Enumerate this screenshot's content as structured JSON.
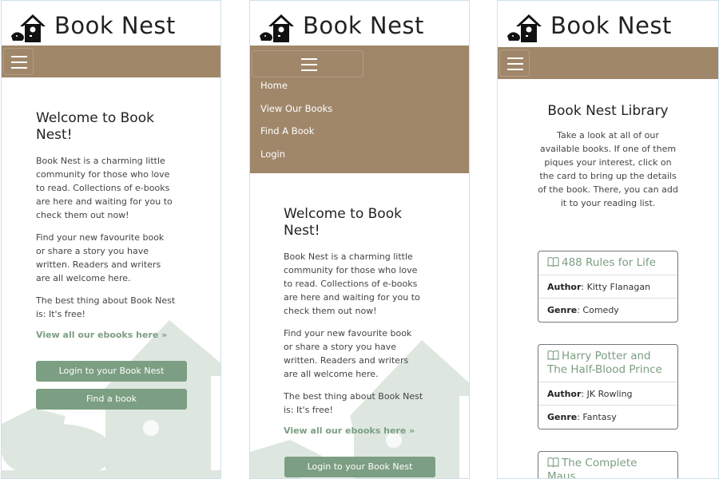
{
  "brand": {
    "name": "Book Nest"
  },
  "colors": {
    "navbar": "#a0876a",
    "accent": "#7c9e82",
    "button": "#7c9e82"
  },
  "nav": {
    "toggle_icon": "hamburger-icon",
    "items": [
      "Home",
      "View Our Books",
      "Find A Book",
      "Login"
    ]
  },
  "home": {
    "heading": "Welcome to Book Nest!",
    "para1": "Book Nest is a charming little community for those who love to read. Collections of e-books are here and waiting for you to check them out now!",
    "para2": "Find your new favourite book or share a story you have written. Readers and writers are all welcome here.",
    "para3": "The best thing about Book Nest is: It's free!",
    "view_link": "View all our ebooks here »",
    "login_button": "Login to your Book Nest",
    "find_button": "Find a book"
  },
  "library": {
    "title": "Book Nest Library",
    "description": "Take a look at all of our available books. If one of them piques your interest, click on the card to bring up the details of the book. There, you can add it to your reading list.",
    "author_label": "Author",
    "genre_label": "Genre",
    "books": [
      {
        "title": "488 Rules for Life",
        "author": "Kitty Flanagan",
        "genre": "Comedy"
      },
      {
        "title": "Harry Potter and The Half-Blood Prince",
        "author": "JK Rowling",
        "genre": "Fantasy"
      },
      {
        "title": "The Complete Maus"
      }
    ]
  }
}
